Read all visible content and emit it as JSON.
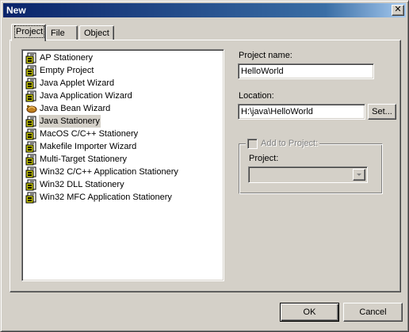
{
  "window": {
    "title": "New",
    "close_glyph": "✕"
  },
  "tabs": [
    {
      "label": "Project",
      "active": true
    },
    {
      "label": "File",
      "active": false
    },
    {
      "label": "Object",
      "active": false
    }
  ],
  "project_list": {
    "items": [
      {
        "label": "AP Stationery",
        "icon": "stationery-icon"
      },
      {
        "label": "Empty Project",
        "icon": "stationery-icon"
      },
      {
        "label": "Java Applet Wizard",
        "icon": "stationery-icon"
      },
      {
        "label": "Java Application Wizard",
        "icon": "stationery-icon"
      },
      {
        "label": "Java Bean Wizard",
        "icon": "java-bean-icon"
      },
      {
        "label": "Java Stationery",
        "icon": "stationery-icon",
        "selected": true
      },
      {
        "label": "MacOS C/C++ Stationery",
        "icon": "stationery-icon"
      },
      {
        "label": "Makefile Importer Wizard",
        "icon": "stationery-icon"
      },
      {
        "label": "Multi-Target Stationery",
        "icon": "stationery-icon"
      },
      {
        "label": "Win32 C/C++ Application Stationery",
        "icon": "stationery-icon"
      },
      {
        "label": "Win32 DLL Stationery",
        "icon": "stationery-icon"
      },
      {
        "label": "Win32 MFC Application Stationery",
        "icon": "stationery-icon"
      }
    ]
  },
  "form": {
    "project_name_label": "Project name:",
    "project_name_value": "HelloWorld",
    "location_label": "Location:",
    "location_value": "H:\\java\\HelloWorld",
    "set_button": "Set...",
    "add_to_project_label": "Add to Project:",
    "project_label": "Project:",
    "project_combo_value": ""
  },
  "buttons": {
    "ok": "OK",
    "cancel": "Cancel"
  },
  "colors": {
    "face": "#d4d0c8",
    "titlebar": "#0a246a",
    "selection": "#d4d0c8"
  }
}
